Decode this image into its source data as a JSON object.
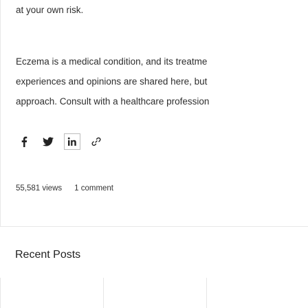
{
  "post": {
    "body_lines": [
      "at your own risk.",
      "Eczema is a medical condition, and its treatme",
      "experiences and opinions are shared here, but",
      "approach. Consult with a healthcare profession"
    ],
    "share_icons": [
      "facebook-icon",
      "twitter-icon",
      "linkedin-icon",
      "link-icon"
    ],
    "views_label": "55,581 views",
    "comments_label": "1 comment"
  },
  "recent_posts": {
    "title": "Recent Posts"
  }
}
